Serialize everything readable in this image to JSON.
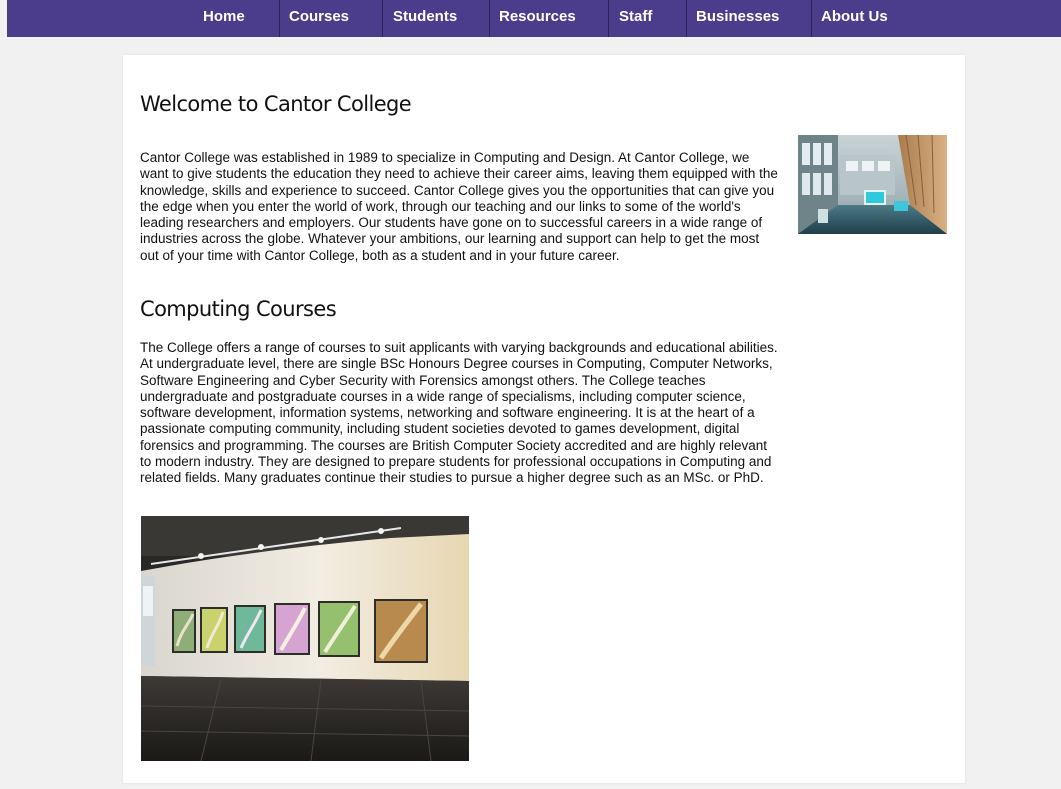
{
  "nav": {
    "items": [
      {
        "label": "Home"
      },
      {
        "label": "Courses"
      },
      {
        "label": "Students"
      },
      {
        "label": "Resources"
      },
      {
        "label": "Staff"
      },
      {
        "label": "Businesses"
      },
      {
        "label": "About Us"
      }
    ]
  },
  "colors": {
    "nav_background": "#4b3c8c",
    "page_background": "#f1f1f1"
  },
  "main": {
    "welcome_heading": "Welcome to Cantor College",
    "welcome_text": "Cantor College was established in 1989 to specialize in Computing and Design. At Cantor College, we want to give students the education they need to achieve their career aims, leaving them equipped with the knowledge, skills and experience to succeed. Cantor College gives you the opportunities that can give you the edge when you enter the world of work, through our teaching and our links to some of the world's leading researchers and employers. Our students have gone on to successful careers in a wide range of industries across the globe. Whatever your ambitions, our learning and support can help to get the most out of your time with Cantor College, both as a student and in your future career.",
    "courses_heading": "Computing Courses",
    "courses_text": "The College offers a range of courses to suit applicants with varying backgrounds and educational abilities. At undergraduate level, there are single BSc Honours Degree courses in Computing, Computer Networks, Software Engineering and Cyber Security with Forensics amongst others. The College teaches undergraduate and postgraduate courses in a wide range of specialisms, including computer science, software development, information systems, networking and software engineering. It is at the heart of a passionate computing community, including student societies devoted to games development, digital forensics and programming. The courses are British Computer Society accredited and are highly relevant to modern industry. They are designed to prepare students for professional occupations in Computing and related fields. Many graduates continue their studies to pursue a higher degree such as an MSc. or PhD."
  }
}
